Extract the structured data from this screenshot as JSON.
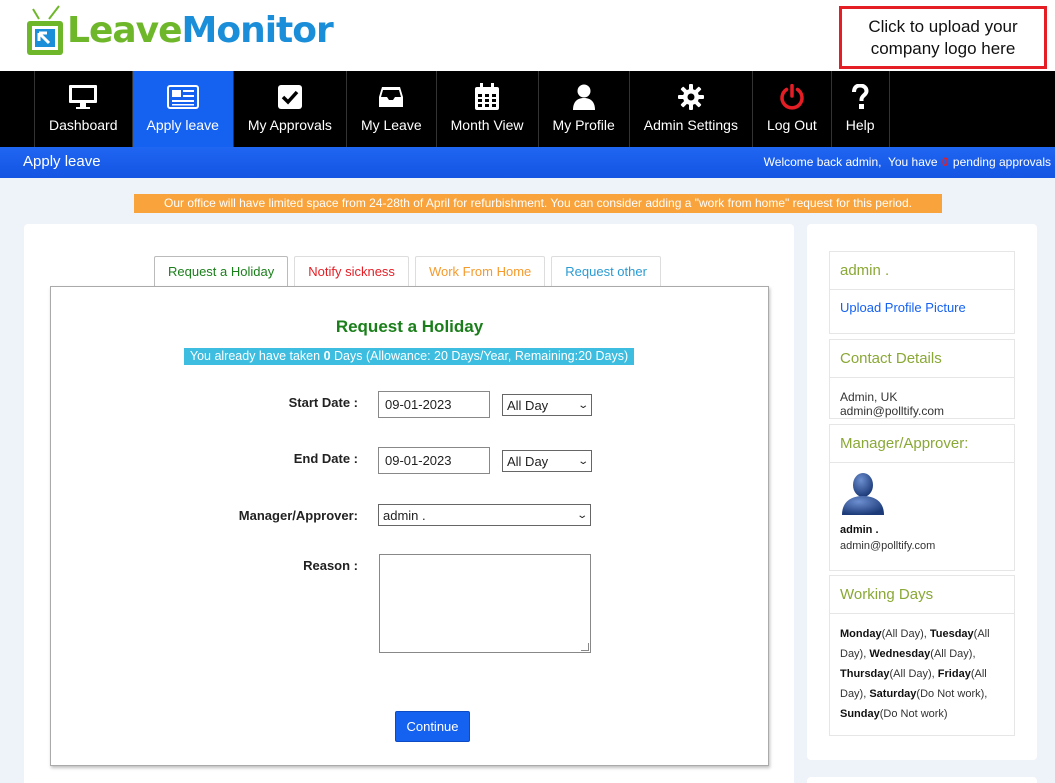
{
  "brand": {
    "name_part1": "Leave",
    "name_part2": "Monitor",
    "upload_logo_text": "Click to upload your company logo here"
  },
  "nav": [
    {
      "label": "Dashboard",
      "icon": "monitor-icon"
    },
    {
      "label": "Apply leave",
      "icon": "newspaper-icon",
      "active": true
    },
    {
      "label": "My Approvals",
      "icon": "checkbox-icon"
    },
    {
      "label": "My Leave",
      "icon": "inbox-icon"
    },
    {
      "label": "Month View",
      "icon": "calendar-icon"
    },
    {
      "label": "My Profile",
      "icon": "user-icon"
    },
    {
      "label": "Admin Settings",
      "icon": "gear-icon"
    },
    {
      "label": "Log Out",
      "icon": "power-icon"
    },
    {
      "label": "Help",
      "icon": "question-icon"
    }
  ],
  "subbar": {
    "title": "Apply leave",
    "welcome": "Welcome back admin,",
    "pending_pre": "You have",
    "pending_count": "0",
    "pending_post": "pending approvals"
  },
  "notice": "Our office will have limited space from 24-28th of April for refurbishment. You can consider adding a \"work from home\" request for this period.",
  "tabs": [
    "Request a Holiday",
    "Notify sickness",
    "Work From Home",
    "Request other"
  ],
  "form": {
    "title": "Request a Holiday",
    "allowance_pre": "You already have taken",
    "allowance_days": "0",
    "allowance_post": "Days (Allowance: 20 Days/Year, Remaining:20 Days)",
    "start_label": "Start Date :",
    "start_value": "09-01-2023",
    "start_period": "All Day",
    "end_label": "End Date :",
    "end_value": "09-01-2023",
    "end_period": "All Day",
    "manager_label": "Manager/Approver:",
    "manager_value": "admin .",
    "reason_label": "Reason :",
    "continue": "Continue"
  },
  "profile": {
    "name": "admin .",
    "upload_picture": "Upload Profile Picture",
    "contact_heading": "Contact Details",
    "contact_text": "Admin, UK admin@polltify.com",
    "approver_heading": "Manager/Approver:",
    "approver_name": "admin .",
    "approver_email": "admin@polltify.com",
    "working_heading": "Working Days",
    "working_days": [
      {
        "day": "Monday",
        "value": "(All Day), "
      },
      {
        "day": "Tuesday",
        "value": "(All Day), "
      },
      {
        "day": "Wednesday",
        "value": "(All Day), "
      },
      {
        "day": "Thursday",
        "value": "(All Day), "
      },
      {
        "day": "Friday",
        "value": "(All Day), "
      },
      {
        "day": "Saturday",
        "value": "(Do Not work), "
      },
      {
        "day": "Sunday",
        "value": "(Do Not work)"
      }
    ]
  },
  "colors": {
    "nav_bg": "#000000",
    "active": "#1561f0",
    "green": "#1a7f1a",
    "accent_olive": "#8aa836",
    "notice": "#f8a33c",
    "allowance": "#3dbde0",
    "logo_box": "#e51e25"
  }
}
